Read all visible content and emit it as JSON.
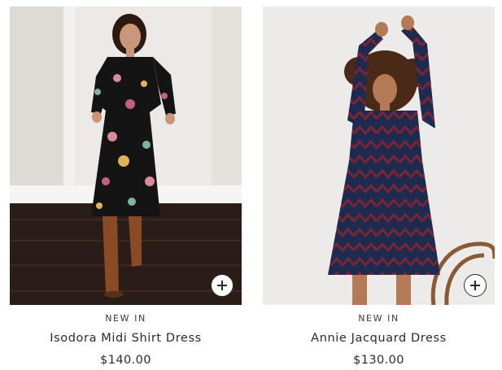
{
  "products": [
    {
      "badge": "NEW IN",
      "title": "Isodora Midi Shirt Dress",
      "price": "$140.00",
      "add_icon": "plus-circle-icon"
    },
    {
      "badge": "NEW IN",
      "title": "Annie Jacquard Dress",
      "price": "$130.00",
      "add_icon": "plus-circle-icon"
    }
  ],
  "colors": {
    "text": "#2b2b2b",
    "dress_black": "#141414",
    "dress_navy": "#1f2a4f",
    "dress_zigzag": "#7a2536",
    "boots": "#8a4a26"
  }
}
